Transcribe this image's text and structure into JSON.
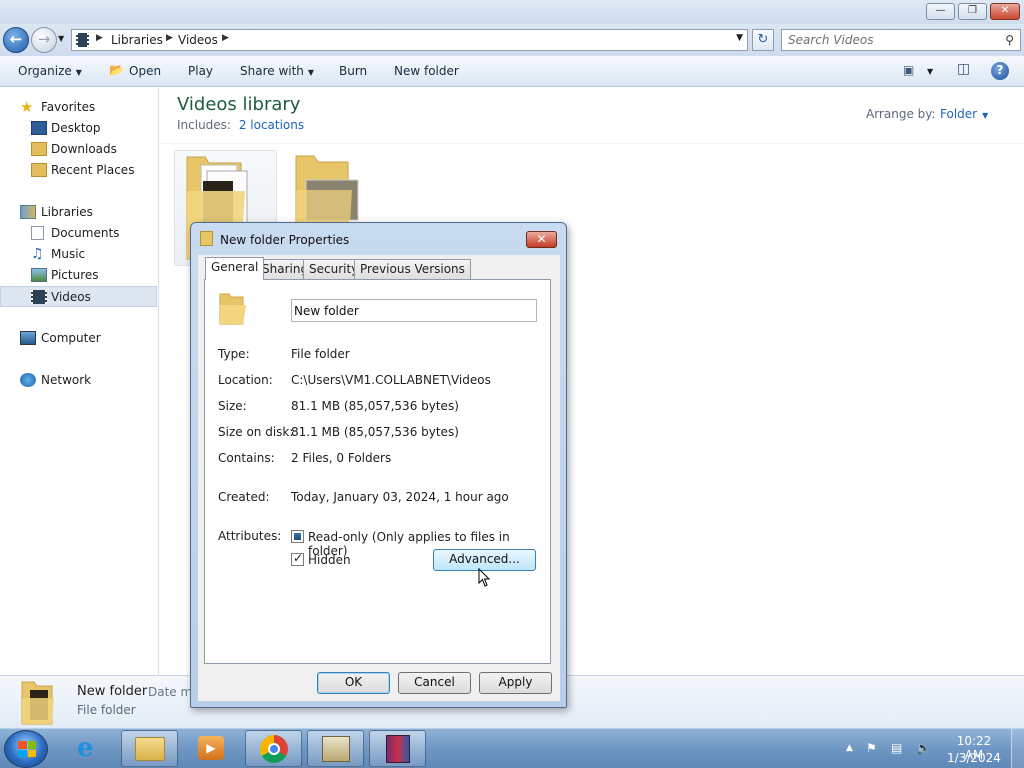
{
  "explorer": {
    "breadcrumb": [
      "Libraries",
      "Videos"
    ],
    "search_placeholder": "Search Videos",
    "toolbar": {
      "organize": "Organize",
      "open": "Open",
      "play": "Play",
      "share_with": "Share with",
      "burn": "Burn",
      "new_folder": "New folder"
    },
    "nav": {
      "favorites": "Favorites",
      "desktop": "Desktop",
      "downloads": "Downloads",
      "recent_places": "Recent Places",
      "libraries": "Libraries",
      "documents": "Documents",
      "music": "Music",
      "pictures": "Pictures",
      "videos": "Videos",
      "computer": "Computer",
      "network": "Network"
    },
    "library": {
      "title": "Videos library",
      "includes_label": "Includes:",
      "includes_link": "2 locations",
      "arrange_label": "Arrange by:",
      "arrange_value": "Folder"
    },
    "details": {
      "name": "New folder",
      "date_label": "Date mo",
      "type": "File folder"
    }
  },
  "dialog": {
    "title": "New folder Properties",
    "tabs": [
      "General",
      "Sharing",
      "Security",
      "Previous Versions"
    ],
    "name_value": "New folder",
    "type_label": "Type:",
    "type_value": "File folder",
    "location_label": "Location:",
    "location_value": "C:\\Users\\VM1.COLLABNET\\Videos",
    "size_label": "Size:",
    "size_value": "81.1 MB (85,057,536 bytes)",
    "size_on_disk_label": "Size on disk:",
    "size_on_disk_value": "81.1 MB (85,057,536 bytes)",
    "contains_label": "Contains:",
    "contains_value": "2 Files, 0 Folders",
    "created_label": "Created:",
    "created_value": "Today, January 03, 2024, 1 hour ago",
    "attributes_label": "Attributes:",
    "readonly_label": "Read-only (Only applies to files in folder)",
    "hidden_label": "Hidden",
    "readonly_state": "indeterminate",
    "hidden_checked": true,
    "advanced_button": "Advanced...",
    "ok_button": "OK",
    "cancel_button": "Cancel",
    "apply_button": "Apply"
  },
  "taskbar": {
    "time": "10:22 AM",
    "date": "1/3/2024",
    "apps": [
      "internet-explorer",
      "windows-explorer",
      "media-player",
      "chrome",
      "video-editor",
      "winrar"
    ]
  },
  "colors": {
    "library_title": "#1e5b3e",
    "link": "#1c64c0",
    "close_red": "#c53b25"
  }
}
